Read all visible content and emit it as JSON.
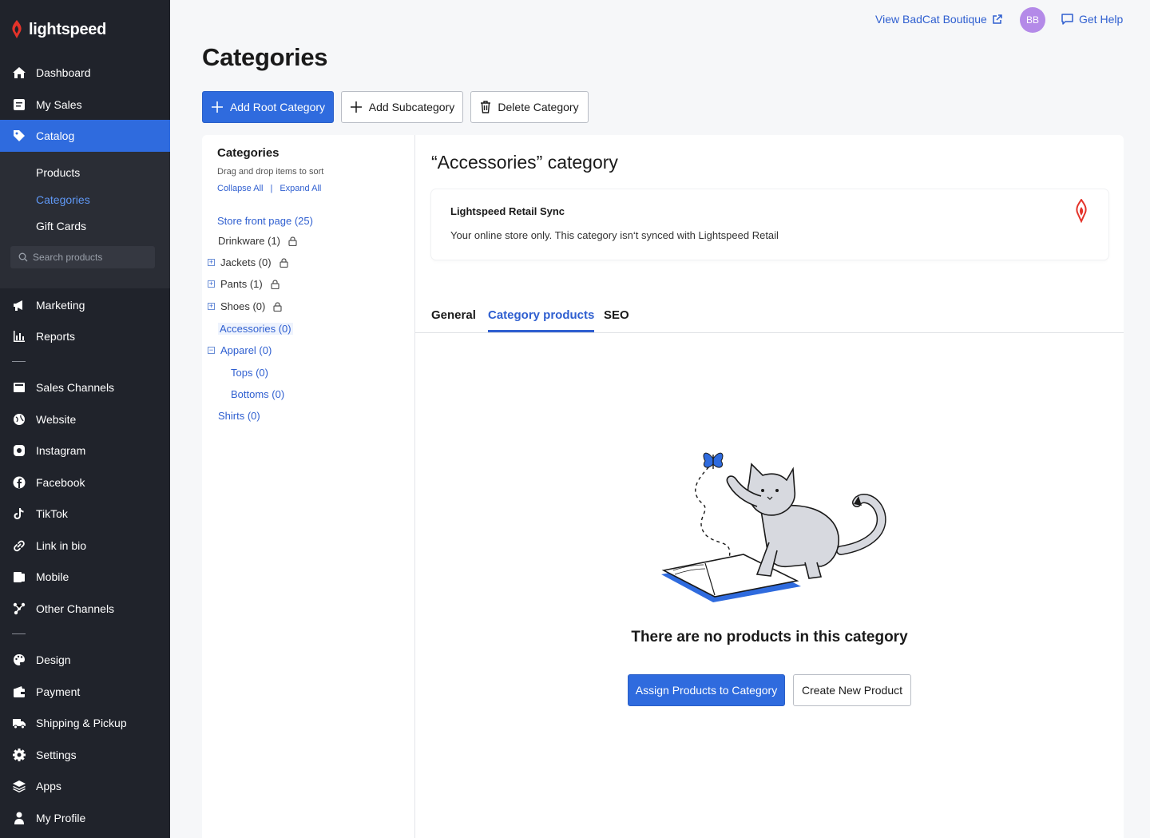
{
  "brand": {
    "name": "lightspeed"
  },
  "topbar": {
    "store_link": "View BadCat Boutique",
    "avatar": "BB",
    "help": "Get Help"
  },
  "sidebar": {
    "items": [
      {
        "label": "Dashboard",
        "icon": "home-icon"
      },
      {
        "label": "My Sales",
        "icon": "sales-icon"
      },
      {
        "label": "Catalog",
        "icon": "tag-icon",
        "active": true
      },
      {
        "label": "Marketing",
        "icon": "megaphone-icon"
      },
      {
        "label": "Reports",
        "icon": "chart-icon"
      },
      {
        "label": "Sales Channels",
        "icon": "store-icon"
      },
      {
        "label": "Website",
        "icon": "globe-icon"
      },
      {
        "label": "Instagram",
        "icon": "instagram-icon"
      },
      {
        "label": "Facebook",
        "icon": "facebook-icon"
      },
      {
        "label": "TikTok",
        "icon": "tiktok-icon"
      },
      {
        "label": "Link in bio",
        "icon": "link-icon"
      },
      {
        "label": "Mobile",
        "icon": "mobile-icon"
      },
      {
        "label": "Other Channels",
        "icon": "channels-icon"
      },
      {
        "label": "Design",
        "icon": "palette-icon"
      },
      {
        "label": "Payment",
        "icon": "wallet-icon"
      },
      {
        "label": "Shipping & Pickup",
        "icon": "truck-icon"
      },
      {
        "label": "Settings",
        "icon": "gear-icon"
      },
      {
        "label": "Apps",
        "icon": "layers-icon"
      },
      {
        "label": "My Profile",
        "icon": "user-icon"
      }
    ],
    "catalog_sub": [
      "Products",
      "Categories",
      "Gift Cards"
    ],
    "search_placeholder": "Search products"
  },
  "page": {
    "title": "Categories",
    "buttons": {
      "add_root": "Add Root Category",
      "add_sub": "Add Subcategory",
      "delete": "Delete Category"
    }
  },
  "tree": {
    "title": "Categories",
    "hint": "Drag and drop items to sort",
    "collapse": "Collapse All",
    "separator": "|",
    "expand": "Expand All",
    "items": [
      "Store front page (25)",
      "Drinkware (1)",
      "Jackets (0)",
      "Pants (1)",
      "Shoes (0)",
      "Accessories (0)",
      "Apparel (0)",
      "Tops (0)",
      "Bottoms (0)",
      "Shirts (0)"
    ]
  },
  "detail": {
    "title": "“Accessories” category",
    "sync_title": "Lightspeed Retail Sync",
    "sync_desc": "Your online store only. This category isn‘t synced with Lightspeed Retail",
    "tabs": [
      "General",
      "Category products",
      "SEO"
    ],
    "empty_text": "There are no products in this category",
    "assign_btn": "Assign Products to Category",
    "create_btn": "Create New Product"
  },
  "colors": {
    "accent": "#2f6bde",
    "sidebar": "#20232b",
    "brand_red": "#e4332a"
  }
}
